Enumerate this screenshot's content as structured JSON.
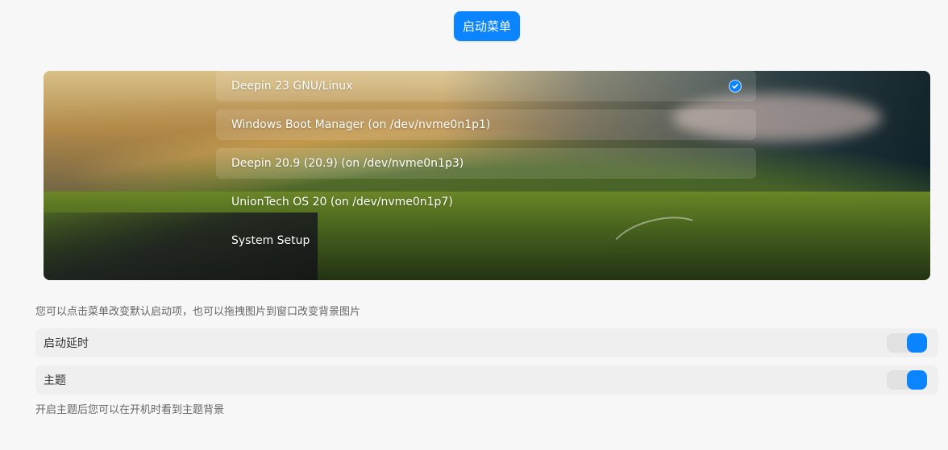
{
  "header": {
    "title_button": "启动菜单"
  },
  "boot_menu": {
    "items": [
      {
        "label": "Deepin 23 GNU/Linux",
        "selected": true
      },
      {
        "label": "Windows Boot Manager (on /dev/nvme0n1p1)",
        "selected": false
      },
      {
        "label": "Deepin 20.9 (20.9) (on /dev/nvme0n1p3)",
        "selected": false
      },
      {
        "label": "UnionTech OS 20  (on /dev/nvme0n1p7)",
        "selected": false
      },
      {
        "label": "System Setup",
        "selected": false
      }
    ],
    "check_icon": "checkmark-icon"
  },
  "help": {
    "text": "您可以点击菜单改变默认启动项，也可以拖拽图片到窗口改变背景图片"
  },
  "settings": {
    "delay": {
      "label": "启动延时",
      "enabled": true
    },
    "theme": {
      "label": "主题",
      "enabled": true
    },
    "theme_note": "开启主题后您可以在开机时看到主题背景"
  },
  "colors": {
    "accent": "#0a84ff",
    "page_background": "#f7f7f7",
    "row_background": "#efefef"
  }
}
